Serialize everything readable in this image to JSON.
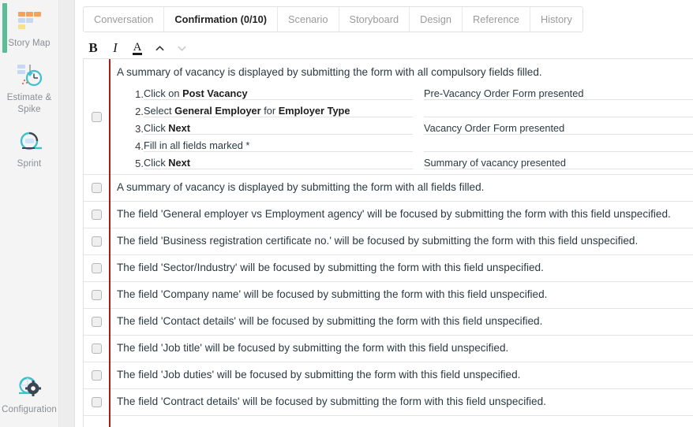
{
  "sidebar": {
    "items": [
      {
        "label": "Story Map",
        "icon": "story-map-icon",
        "active": true
      },
      {
        "label": "Estimate & Spike",
        "icon": "estimate-spike-icon",
        "active": false
      },
      {
        "label": "Sprint",
        "icon": "sprint-icon",
        "active": false
      }
    ],
    "bottom": {
      "label": "Configuration",
      "icon": "configuration-gear-icon"
    },
    "accent_color": "#5bbd97"
  },
  "tabs": [
    {
      "label": "Conversation",
      "active": false
    },
    {
      "label": "Confirmation (0/10)",
      "active": true
    },
    {
      "label": "Scenario",
      "active": false
    },
    {
      "label": "Storyboard",
      "active": false
    },
    {
      "label": "Design",
      "active": false
    },
    {
      "label": "Reference",
      "active": false
    },
    {
      "label": "History",
      "active": false
    }
  ],
  "toolbar": {
    "bold_label": "B",
    "italic_label": "I",
    "text_color_label": "A",
    "collapse_icon": "chevron-up-icon",
    "expand_icon": "chevron-down-icon"
  },
  "editor": {
    "marker_color": "#a61b1b",
    "rows": [
      {
        "checked": false,
        "title": "A summary of vacancy is displayed by submitting the form with all compulsory fields filled.",
        "expanded": true,
        "steps": [
          {
            "num": "1.",
            "action_plain": "Click on ",
            "action_bold": "Post Vacancy",
            "action_tail": "",
            "result": "Pre-Vacancy Order Form presented"
          },
          {
            "num": "2.",
            "action_plain": "Select ",
            "action_bold": "General Employer",
            "action_mid": " for ",
            "action_bold2": "Employer Type",
            "action_tail": "",
            "result": ""
          },
          {
            "num": "3.",
            "action_plain": "Click ",
            "action_bold": "Next",
            "action_tail": "",
            "result": "Vacancy Order Form presented"
          },
          {
            "num": "4.",
            "action_plain": "Fill in all fields marked *",
            "action_bold": "",
            "action_tail": "",
            "result": ""
          },
          {
            "num": "5.",
            "action_plain": "Click ",
            "action_bold": "Next",
            "action_tail": "",
            "result": "Summary of vacancy presented"
          }
        ]
      },
      {
        "checked": false,
        "title": "A summary of vacancy is displayed by submitting the form with all fields filled.",
        "expanded": false,
        "steps": []
      },
      {
        "checked": false,
        "title": "The field 'General employer vs Employment agency' will be focused by submitting the form with this field unspecified.",
        "expanded": false,
        "steps": []
      },
      {
        "checked": false,
        "title": "The field 'Business registration certificate no.' will be focused by submitting the form with this field unspecified.",
        "expanded": false,
        "steps": []
      },
      {
        "checked": false,
        "title": "The field 'Sector/Industry' will be focused by submitting the form with this field unspecified.",
        "expanded": false,
        "steps": []
      },
      {
        "checked": false,
        "title": "The field 'Company name' will be focused by submitting the form with this field unspecified.",
        "expanded": false,
        "steps": []
      },
      {
        "checked": false,
        "title": "The field 'Contact details' will be focused by submitting the form with this field unspecified.",
        "expanded": false,
        "steps": []
      },
      {
        "checked": false,
        "title": "The field 'Job title' will be focused by submitting the form with this field unspecified.",
        "expanded": false,
        "steps": []
      },
      {
        "checked": false,
        "title": "The field 'Job duties' will be focused by submitting the form with this field unspecified.",
        "expanded": false,
        "steps": []
      },
      {
        "checked": false,
        "title": "The field 'Contract details' will be focused by submitting the form with this field unspecified.",
        "expanded": false,
        "steps": []
      }
    ]
  }
}
